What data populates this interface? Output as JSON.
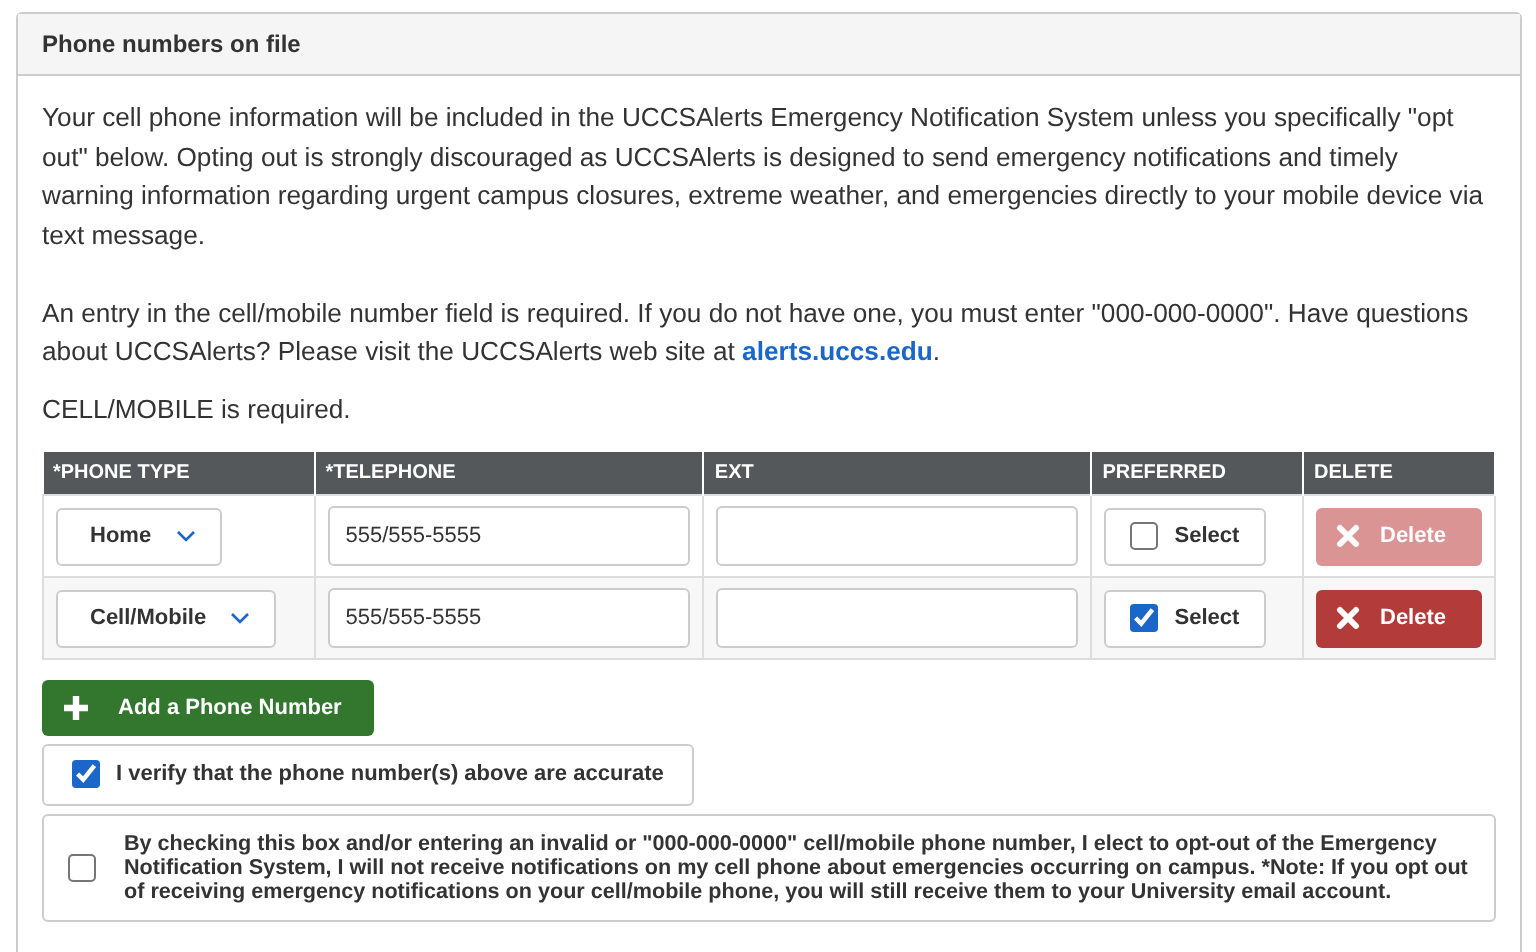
{
  "panel": {
    "title": "Phone numbers on file"
  },
  "intro": "Your cell phone information will be included in the UCCSAlerts Emergency Notification System unless you specifically \"opt out\" below. Opting out is strongly discouraged as UCCSAlerts is designed to send emergency notifications and timely warning information regarding urgent campus closures, extreme weather, and emergencies directly to your mobile device via text message.",
  "requirement": {
    "text": "An entry in the cell/mobile number field is required. If you do not have one, you must enter \"000-000-0000\". Have questions about UCCSAlerts? Please visit the UCCSAlerts web site at ",
    "link": "alerts.uccs.edu",
    "after": "."
  },
  "required_note": "CELL/MOBILE is required.",
  "table": {
    "columns": [
      "*PHONE TYPE",
      "*TELEPHONE",
      "EXT",
      "PREFERRED",
      "DELETE"
    ],
    "rows": [
      {
        "phone_type": "Home",
        "telephone": "555/555-5555",
        "preferred_label": "Select",
        "preferred": false,
        "delete_label": "Delete",
        "delete_disabled": true
      },
      {
        "phone_type": "Cell/Mobile",
        "telephone": "555/555-5555",
        "preferred_label": "Select",
        "preferred": true,
        "delete_label": "Delete",
        "delete_disabled": false
      }
    ]
  },
  "add_button": "Add a Phone Number",
  "verify": {
    "label": "I verify that the phone number(s) above are accurate",
    "checked": true
  },
  "opt_out": {
    "label": "By checking this box and/or entering an invalid or \"000-000-0000\" cell/mobile phone number, I elect to opt-out of the Emergency Notification System, I will not receive notifications on my cell phone about emergencies occurring on campus. *Note: If you opt out of receiving emergency notifications on your cell/mobile phone, you will still receive them to your University email account.",
    "checked": false
  }
}
